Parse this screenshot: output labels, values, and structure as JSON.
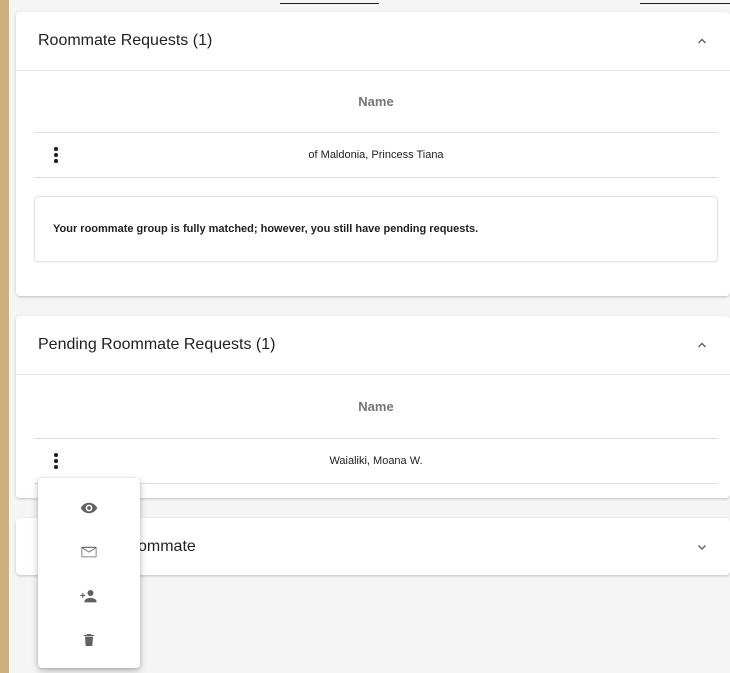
{
  "panels": {
    "roommate_requests": {
      "title": "Roommate Requests (1)",
      "column_header": "Name",
      "rows": [
        {
          "name": "of Maldonia, Princess Tiana"
        }
      ],
      "notice": "Your roommate group is fully matched; however, you still have pending requests.",
      "expanded": true
    },
    "pending_requests": {
      "title": "Pending Roommate Requests (1)",
      "column_header": "Name",
      "rows": [
        {
          "name": "Waialiki, Moana W."
        }
      ],
      "expanded": true
    },
    "third_panel": {
      "title_visible_fragment": "ommate",
      "expanded": false
    }
  },
  "context_menu": {
    "items": [
      {
        "icon": "eye-icon"
      },
      {
        "icon": "mail-icon"
      },
      {
        "icon": "person-add-icon"
      },
      {
        "icon": "trash-icon"
      }
    ]
  },
  "colors": {
    "page_border": "#cfb07a",
    "background": "#f5f5f5",
    "card": "#ffffff",
    "icon": "#616161",
    "text": "#212121",
    "header_text": "#757575"
  }
}
